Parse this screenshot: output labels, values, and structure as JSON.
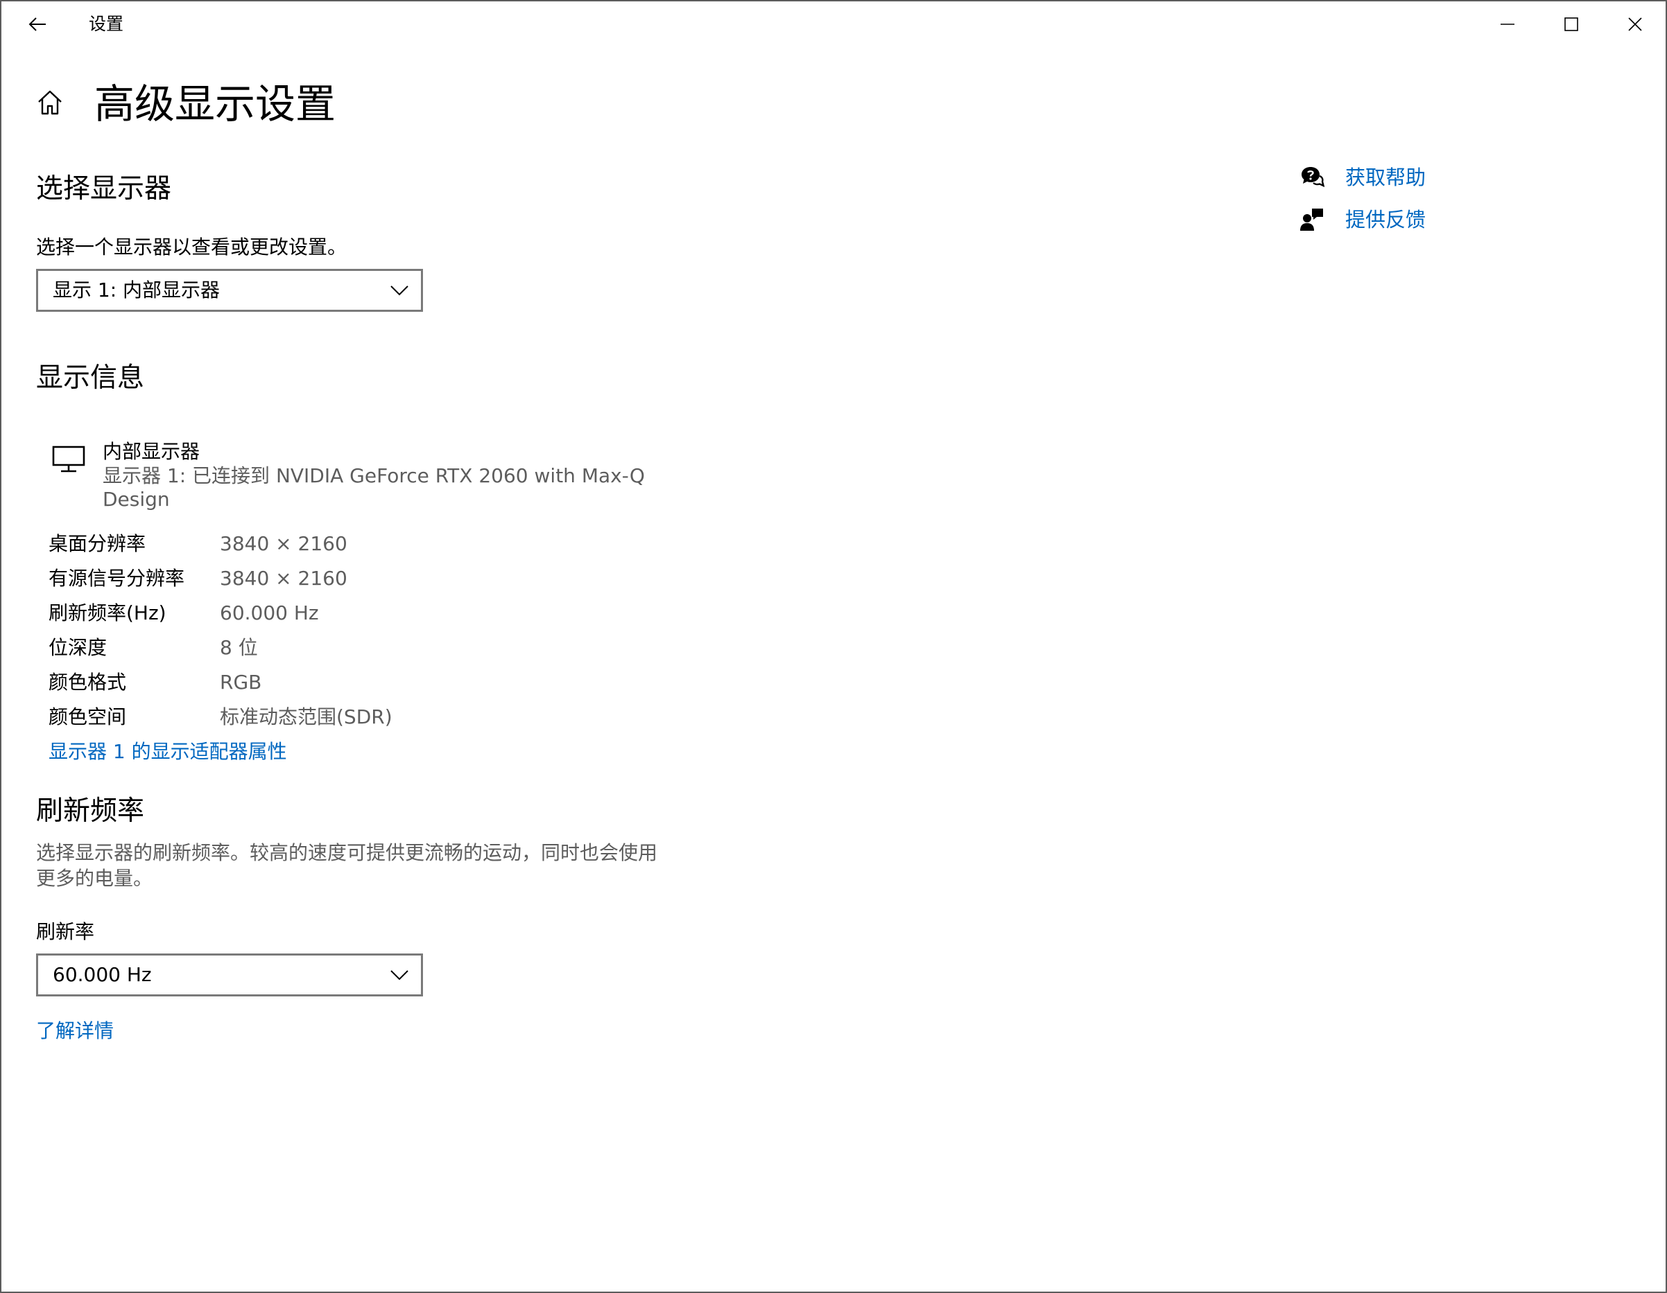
{
  "window": {
    "title": "设置",
    "back_icon": "back-arrow-icon",
    "minimize_icon": "minimize-icon",
    "maximize_icon": "maximize-icon",
    "close_icon": "close-icon"
  },
  "page": {
    "home_icon": "home-icon",
    "title": "高级显示设置"
  },
  "select_display": {
    "heading": "选择显示器",
    "description": "选择一个显示器以查看或更改设置。",
    "dropdown_value": "显示 1: 内部显示器"
  },
  "display_info": {
    "heading": "显示信息",
    "monitor_icon": "monitor-icon",
    "monitor_name": "内部显示器",
    "monitor_desc_line1": "显示器 1: 已连接到 NVIDIA GeForce RTX 2060 with Max-Q",
    "monitor_desc_line2": "Design",
    "rows": [
      {
        "label": "桌面分辨率",
        "value": "3840 × 2160"
      },
      {
        "label": "有源信号分辨率",
        "value": "3840 × 2160"
      },
      {
        "label": "刷新频率(Hz)",
        "value": "60.000 Hz"
      },
      {
        "label": "位深度",
        "value": "8 位"
      },
      {
        "label": "颜色格式",
        "value": "RGB"
      },
      {
        "label": "颜色空间",
        "value": "标准动态范围(SDR)"
      }
    ],
    "adapter_link": "显示器 1 的显示适配器属性"
  },
  "refresh_rate": {
    "heading": "刷新频率",
    "description_line1": "选择显示器的刷新频率。较高的速度可提供更流畅的运动，同时也会使用",
    "description_line2": "更多的电量。",
    "field_label": "刷新率",
    "dropdown_value": "60.000 Hz",
    "learn_more_link": "了解详情"
  },
  "help": {
    "get_help": "获取帮助",
    "get_help_icon": "chat-help-icon",
    "feedback": "提供反馈",
    "feedback_icon": "feedback-person-icon"
  },
  "colors": {
    "accent": "#0067c0",
    "secondary_text": "#5d5d5d",
    "control_border": "#7a7a7a"
  }
}
